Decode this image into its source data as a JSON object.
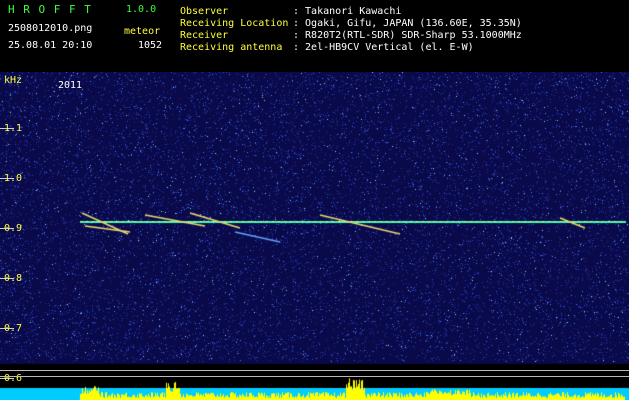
{
  "header": {
    "app_name": "H R O F F T",
    "version": "1.0.0",
    "filename": "2508012010.png",
    "mode": "meteor",
    "datetime": "25.08.01 20:10",
    "count": "1052",
    "observer_label": "Observer",
    "observer_value": ": Takanori Kawachi",
    "location_label": "Receiving Location",
    "location_value": ": Ogaki, Gifu, JAPAN (136.60E, 35.35N)",
    "receiver_label": "Receiver",
    "receiver_value": ": R820T2(RTL-SDR) SDR-Sharp 53.1000MHz",
    "antenna_label": "Receiving antenna",
    "antenna_value": ": 2el-HB9CV Vertical (el. E-W)"
  },
  "plot": {
    "unit": "kHz",
    "frame_label": "2011",
    "y_ticks": [
      "1.1",
      "1.0",
      "0.9",
      "0.8",
      "0.7",
      "0.6"
    ]
  },
  "colors": {
    "background": "#000000",
    "plot_bg": "#0a0a4a",
    "carrier": "#40ffb0",
    "label_green": "#3cff3c",
    "label_yellow": "#ffff3c",
    "bottom_bar": "#00ccff",
    "peaks": "#ffff00"
  }
}
